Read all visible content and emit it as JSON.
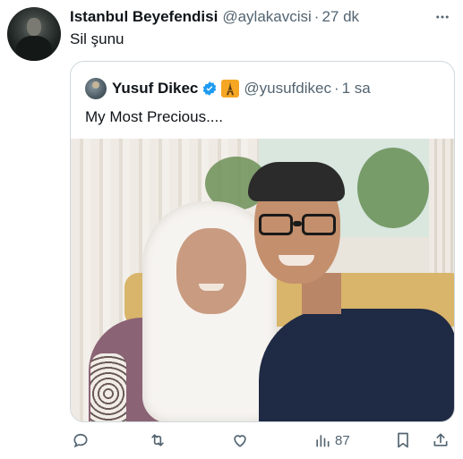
{
  "tweet": {
    "author_name": "Istanbul Beyefendisi",
    "author_handle": "@aylakavcisi",
    "separator": "·",
    "timestamp": "27 dk",
    "text": "Sil şunu"
  },
  "quoted_tweet": {
    "author_name": "Yusuf Dikec",
    "author_handle": "@yusufdikec",
    "separator": "·",
    "timestamp": "1 sa",
    "text": "My Most Precious....",
    "badges": [
      "verified-icon",
      "eiffel-tower-emoji"
    ]
  },
  "actions": {
    "reply_icon": "reply-icon",
    "retweet_icon": "retweet-icon",
    "like_icon": "heart-icon",
    "views_icon": "analytics-icon",
    "views_count": "87",
    "bookmark_icon": "bookmark-icon",
    "share_icon": "share-icon"
  },
  "colors": {
    "text_primary": "#0f1419",
    "text_secondary": "#536471",
    "verified_blue": "#1d9bf0",
    "border": "#cfd9de"
  }
}
